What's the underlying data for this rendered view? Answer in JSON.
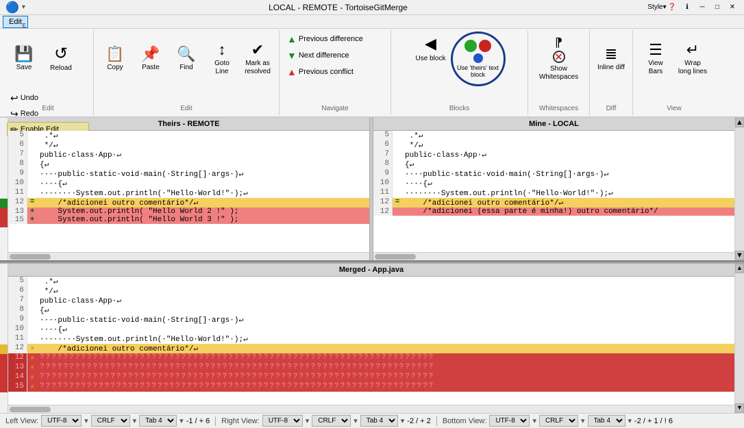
{
  "titleBar": {
    "title": "LOCAL - REMOTE - TortoiseGitMerge",
    "styleLabel": "Style",
    "minBtn": "─",
    "maxBtn": "□",
    "closeBtn": "✕"
  },
  "menuBar": {
    "items": [
      "Edit"
    ]
  },
  "toolbar": {
    "groups": [
      {
        "label": "Edit",
        "buttons": [
          {
            "id": "save",
            "icon": "💾",
            "label": "Save"
          },
          {
            "id": "reload",
            "icon": "↺",
            "label": "Reload"
          }
        ],
        "smallButtons": [
          {
            "id": "undo",
            "label": "Undo"
          },
          {
            "id": "redo",
            "label": "Redo"
          },
          {
            "id": "enableEdit",
            "label": "Enable Edit"
          }
        ]
      }
    ],
    "copyBtn": "Copy",
    "pasteBtn": "Paste",
    "findBtn": "Find",
    "gotoBtn": "Goto\nLine",
    "markBtn": "Mark as\nresolved",
    "navigateLabel": "Navigate",
    "prevDiff": "Previous difference",
    "nextDiff": "Next difference",
    "prevConflict": "Previous conflict",
    "useBlock": "Use block",
    "useTheirsBlock": "Use 'theirs'\ntext block",
    "blocksLabel": "Blocks",
    "showWhitespace": "Show\nWhitespaces",
    "whitespaceLabel": "Whitespaces",
    "inlineDiff": "Inline\ndiff",
    "viewBars": "View\nBars",
    "wrapLongLines": "Wrap\nlong lines",
    "viewLabel": "View",
    "diffLabel": "Diff"
  },
  "panels": {
    "theirs": "Theirs - REMOTE",
    "mine": "Mine - LOCAL",
    "merged": "Merged - App.java"
  },
  "theirsLines": [
    {
      "num": "5",
      "marker": " ",
      "content": " .*↵",
      "style": "normal"
    },
    {
      "num": "6",
      "marker": " ",
      "content": " */↵",
      "style": "normal"
    },
    {
      "num": "7",
      "marker": " ",
      "content": "public·class·App·↵",
      "style": "normal"
    },
    {
      "num": "8",
      "marker": " ",
      "content": "{↵",
      "style": "normal"
    },
    {
      "num": "9",
      "marker": " ",
      "content": "····public·static·void·main(·String[]·args·)↵",
      "style": "normal"
    },
    {
      "num": "10",
      "marker": " ",
      "content": "····{↵",
      "style": "normal"
    },
    {
      "num": "11",
      "marker": " ",
      "content": "········System.out.println(·\"Hello·World!\"·);↵",
      "style": "normal"
    },
    {
      "num": "12",
      "marker": "=",
      "content": "    /*adicionei outro comentário*/↵",
      "style": "yellow"
    },
    {
      "num": "13",
      "marker": "+",
      "content": "    System.out.println( \"Hello World 2 !\" );",
      "style": "red"
    },
    {
      "num": "15",
      "marker": "+",
      "content": "    System.out.println( \"Hello World 3 !\" );",
      "style": "red"
    }
  ],
  "mineLines": [
    {
      "num": "5",
      "marker": " ",
      "content": " .*↵",
      "style": "normal"
    },
    {
      "num": "6",
      "marker": " ",
      "content": " */↵",
      "style": "normal"
    },
    {
      "num": "7",
      "marker": " ",
      "content": "public·class·App·↵",
      "style": "normal"
    },
    {
      "num": "8",
      "marker": " ",
      "content": "{↵",
      "style": "normal"
    },
    {
      "num": "9",
      "marker": " ",
      "content": "····public·static·void·main(·String[]·args·)↵",
      "style": "normal"
    },
    {
      "num": "10",
      "marker": " ",
      "content": "····{↵",
      "style": "normal"
    },
    {
      "num": "11",
      "marker": " ",
      "content": "········System.out.println(·\"Hello·World!\"·);↵",
      "style": "normal"
    },
    {
      "num": "12",
      "marker": "=",
      "content": "    /*adicionei outro comentário*/↵",
      "style": "yellow"
    },
    {
      "num": "12",
      "marker": " ",
      "content": "    /*adicionei (essa parte é minha!) outro comentário*/",
      "style": "red"
    }
  ],
  "mergedLines": [
    {
      "num": "5",
      "marker": " ",
      "content": " .*↵",
      "style": "normal"
    },
    {
      "num": "6",
      "marker": " ",
      "content": " */↵",
      "style": "normal"
    },
    {
      "num": "7",
      "marker": " ",
      "content": "public·class·App·↵",
      "style": "normal"
    },
    {
      "num": "8",
      "marker": " ",
      "content": "{↵",
      "style": "normal"
    },
    {
      "num": "9",
      "marker": " ",
      "content": "····public·static·void·main(·String[]·args·)↵",
      "style": "normal"
    },
    {
      "num": "10",
      "marker": " ",
      "content": "····{↵",
      "style": "normal"
    },
    {
      "num": "11",
      "marker": " ",
      "content": "········System.out.println(·\"Hello·World!\"·);↵",
      "style": "normal"
    },
    {
      "num": "12",
      "marker": "⚡",
      "content": "    /*adicionei outro comentário*/↵",
      "style": "yellow"
    },
    {
      "num": "12",
      "marker": "⚡",
      "content": "???????????????????????????????????????????????????",
      "style": "conflict-red"
    },
    {
      "num": "13",
      "marker": "⚡",
      "content": "???????????????????????????????????????????????????",
      "style": "conflict-red"
    },
    {
      "num": "14",
      "marker": "⚡",
      "content": "???????????????????????????????????????????????????",
      "style": "conflict-red"
    },
    {
      "num": "15",
      "marker": "⚡",
      "content": "???????????????????????????????????????????????????",
      "style": "conflict-red"
    }
  ],
  "statusBar": {
    "leftView": "Left View:",
    "leftEncoding": "UTF-8",
    "leftEol": "CRLF",
    "leftTab": "Tab 4",
    "leftPos": "-1 / + 6",
    "rightView": "Right View:",
    "rightEncoding": "UTF-8",
    "rightEol": "CRLF",
    "rightTab": "Tab 4",
    "rightPos": "-2 / + 2",
    "bottomView": "Bottom View:",
    "bottomEncoding": "UTF-8",
    "bottomEol": "CRLF",
    "bottomTab": "Tab 4",
    "bottomPos": "-2 / + 1 / ! 6"
  }
}
